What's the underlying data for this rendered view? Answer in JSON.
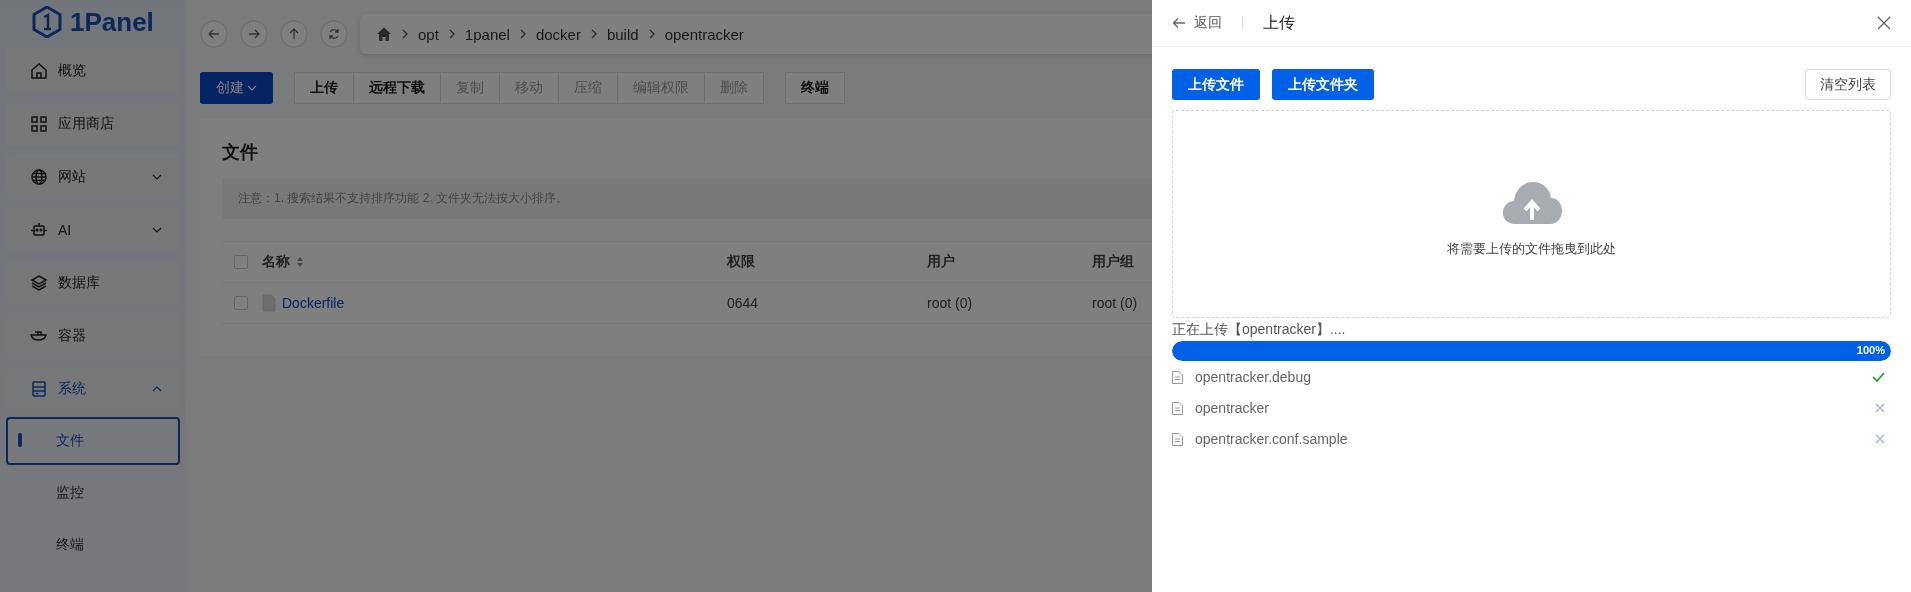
{
  "logo": {
    "name": "1Panel"
  },
  "sidebar": {
    "items": [
      {
        "label": "概览",
        "selected": false
      },
      {
        "label": "应用商店",
        "selected": false
      },
      {
        "label": "网站",
        "selected": false,
        "expanded": false
      },
      {
        "label": "AI",
        "selected": false,
        "expanded": false
      },
      {
        "label": "数据库",
        "selected": false
      },
      {
        "label": "容器",
        "selected": false
      },
      {
        "label": "系统",
        "selected": true,
        "expanded": true,
        "children": [
          {
            "label": "文件",
            "selected": true
          },
          {
            "label": "监控",
            "selected": false
          },
          {
            "label": "终端",
            "selected": false
          }
        ]
      }
    ]
  },
  "breadcrumb": [
    "opt",
    "1panel",
    "docker",
    "build",
    "opentracker"
  ],
  "toolbar": {
    "create": "创建",
    "groups": [
      [
        {
          "label": "上传",
          "disabled": false
        },
        {
          "label": "远程下载",
          "disabled": false
        },
        {
          "label": "复制",
          "disabled": true
        },
        {
          "label": "移动",
          "disabled": true
        },
        {
          "label": "压缩",
          "disabled": true
        },
        {
          "label": "编辑权限",
          "disabled": true
        },
        {
          "label": "删除",
          "disabled": true
        }
      ],
      [
        {
          "label": "终端",
          "disabled": false
        }
      ]
    ]
  },
  "files": {
    "title": "文件",
    "notice": "注意：1. 搜索结果不支持排序功能 2. 文件夹无法按大小排序。",
    "all_checked": false,
    "columns": [
      "名称",
      "权限",
      "用户",
      "用户组"
    ],
    "rows": [
      {
        "name": "Dockerfile",
        "mode": "0644",
        "user": "root (0)",
        "group": "root (0)",
        "checked": false
      }
    ]
  },
  "drawer": {
    "back": "返回",
    "title": "上传",
    "buttons": [
      "上传文件",
      "上传文件夹"
    ],
    "clear": "清空列表",
    "dropzone": "将需要上传的文件拖曳到此处",
    "status": "正在上传【opentracker】....",
    "progress": {
      "level": 1,
      "reading": "100%"
    },
    "items": [
      {
        "name": "opentracker.debug",
        "uploaded": true
      },
      {
        "name": "opentracker",
        "uploaded": false
      },
      {
        "name": "opentracker.conf.sample",
        "uploaded": false
      }
    ]
  }
}
